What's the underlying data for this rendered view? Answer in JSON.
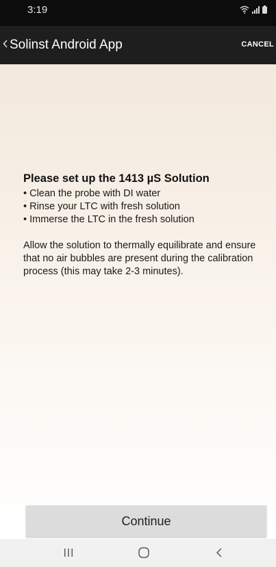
{
  "status_bar": {
    "time": "3:19",
    "icons": [
      "wifi-icon",
      "signal-icon",
      "battery-icon"
    ]
  },
  "app_bar": {
    "back_icon": "chevron-left-icon",
    "title": "Solinst Android App",
    "cancel_label": "CANCEL"
  },
  "instructions": {
    "heading": "Please set up the 1413 µS Solution",
    "bullets": [
      "• Clean the probe with DI water",
      "• Rinse your LTC with fresh solution",
      "• Immerse the LTC in the fresh solution"
    ],
    "paragraph": "Allow the solution to thermally equilibrate and ensure that no air bubbles are present during the calibration process (this may take 2-3 minutes)."
  },
  "continue_label": "Continue",
  "nav_bar": {
    "buttons": [
      "recent-apps-icon",
      "home-icon",
      "back-icon"
    ]
  },
  "colors": {
    "status_bar": "#0c0c0c",
    "app_bar": "#1e1e1e",
    "content_top": "#f3e9dc",
    "content_bottom": "#ffffff",
    "button": "#dcdcdc",
    "nav_bar": "#f1f1f1"
  }
}
